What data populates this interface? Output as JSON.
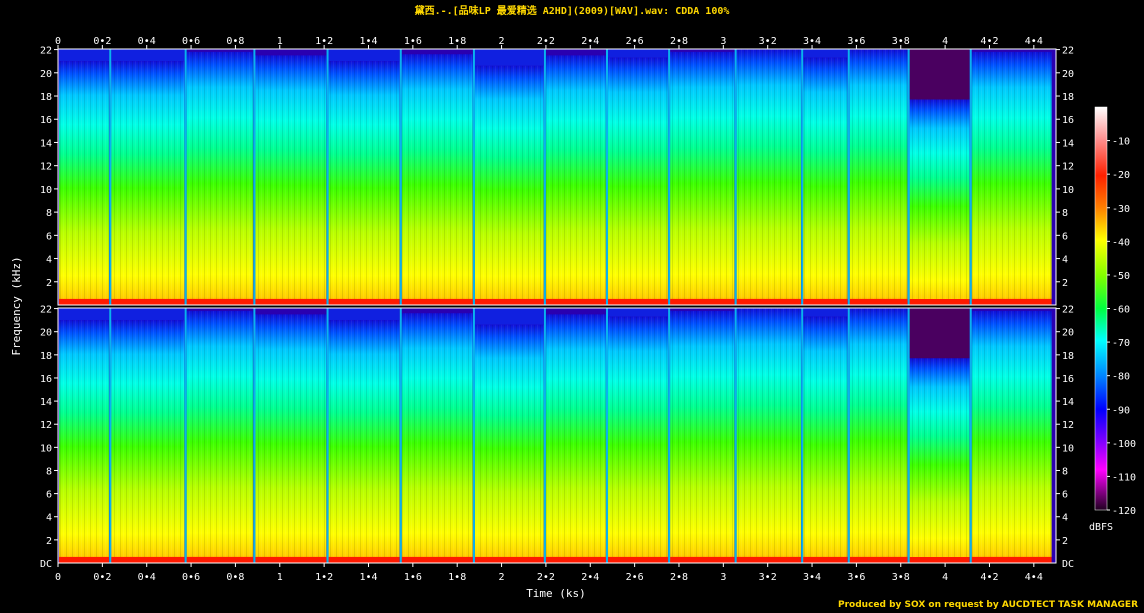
{
  "title": "黛西.-.[品味LP 最爱精选 A2HD](2009)[WAV].wav: CDDA 100%",
  "credit": "Produced by SOX on request by AUCDTECT TASK MANAGER",
  "colors": {
    "title": "#ffd800",
    "background": "#000000",
    "gridline": "#ffffff"
  },
  "chart_data": {
    "type": "heatmap",
    "title": "黛西.-.[品味LP 最爱精选 A2HD](2009)[WAV].wav: CDDA 100%",
    "xlabel": "Time (ks)",
    "ylabel": "Frequency (kHz)",
    "xlim": [
      0,
      4.5
    ],
    "ylim": [
      0,
      22.05
    ],
    "x_ticks": [
      "0",
      "0•2",
      "0•4",
      "0•6",
      "0•8",
      "1",
      "1•2",
      "1•4",
      "1•6",
      "1•8",
      "2",
      "2•2",
      "2•4",
      "2•6",
      "2•8",
      "3",
      "3•2",
      "3•4",
      "3•6",
      "3•8",
      "4",
      "4•2",
      "4•4"
    ],
    "x_tick_values": [
      0,
      0.2,
      0.4,
      0.6,
      0.8,
      1.0,
      1.2,
      1.4,
      1.6,
      1.8,
      2.0,
      2.2,
      2.4,
      2.6,
      2.8,
      3.0,
      3.2,
      3.4,
      3.6,
      3.8,
      4.0,
      4.2,
      4.4
    ],
    "y_ticks_left_top": [
      "2",
      "4",
      "6",
      "8",
      "10",
      "12",
      "14",
      "16",
      "18",
      "20",
      "22"
    ],
    "y_ticks_left_bottom": [
      "DC",
      "2",
      "4",
      "6",
      "8",
      "10",
      "12",
      "14",
      "16",
      "18",
      "20",
      "22"
    ],
    "y_ticks_right_top": [
      "2",
      "4",
      "6",
      "8",
      "10",
      "12",
      "14",
      "16",
      "18",
      "20",
      "22"
    ],
    "y_ticks_right_bottom": [
      "DC",
      "2",
      "4",
      "6",
      "8",
      "10",
      "12",
      "14",
      "16",
      "18",
      "20",
      "22"
    ],
    "y_tick_values": [
      2,
      4,
      6,
      8,
      10,
      12,
      14,
      16,
      18,
      20,
      22
    ],
    "channels": 2,
    "colorbar": {
      "label": "dBFS",
      "ticks": [
        "-10",
        "-20",
        "-30",
        "-40",
        "-50",
        "-60",
        "-70",
        "-80",
        "-90",
        "-100",
        "-110",
        "-120"
      ],
      "tick_values": [
        -10,
        -20,
        -30,
        -40,
        -50,
        -60,
        -70,
        -80,
        -90,
        -100,
        -110,
        -120
      ],
      "range": [
        -120,
        0
      ]
    },
    "tracks": [
      {
        "start": 0.005,
        "end": 0.23,
        "cutoff_khz": 21.0
      },
      {
        "start": 0.24,
        "end": 0.57,
        "cutoff_khz": 21.0
      },
      {
        "start": 0.58,
        "end": 0.88,
        "cutoff_khz": 21.8
      },
      {
        "start": 0.89,
        "end": 1.21,
        "cutoff_khz": 21.5
      },
      {
        "start": 1.22,
        "end": 1.54,
        "cutoff_khz": 21.0
      },
      {
        "start": 1.55,
        "end": 1.87,
        "cutoff_khz": 21.6
      },
      {
        "start": 1.88,
        "end": 2.19,
        "cutoff_khz": 20.6
      },
      {
        "start": 2.2,
        "end": 2.47,
        "cutoff_khz": 21.5
      },
      {
        "start": 2.48,
        "end": 2.75,
        "cutoff_khz": 21.3
      },
      {
        "start": 2.76,
        "end": 3.05,
        "cutoff_khz": 21.8
      },
      {
        "start": 3.06,
        "end": 3.35,
        "cutoff_khz": 22.0
      },
      {
        "start": 3.36,
        "end": 3.56,
        "cutoff_khz": 21.3
      },
      {
        "start": 3.57,
        "end": 3.83,
        "cutoff_khz": 22.0
      },
      {
        "start": 3.84,
        "end": 4.11,
        "cutoff_khz": 17.7
      },
      {
        "start": 4.12,
        "end": 4.48,
        "cutoff_khz": 21.8
      }
    ]
  }
}
